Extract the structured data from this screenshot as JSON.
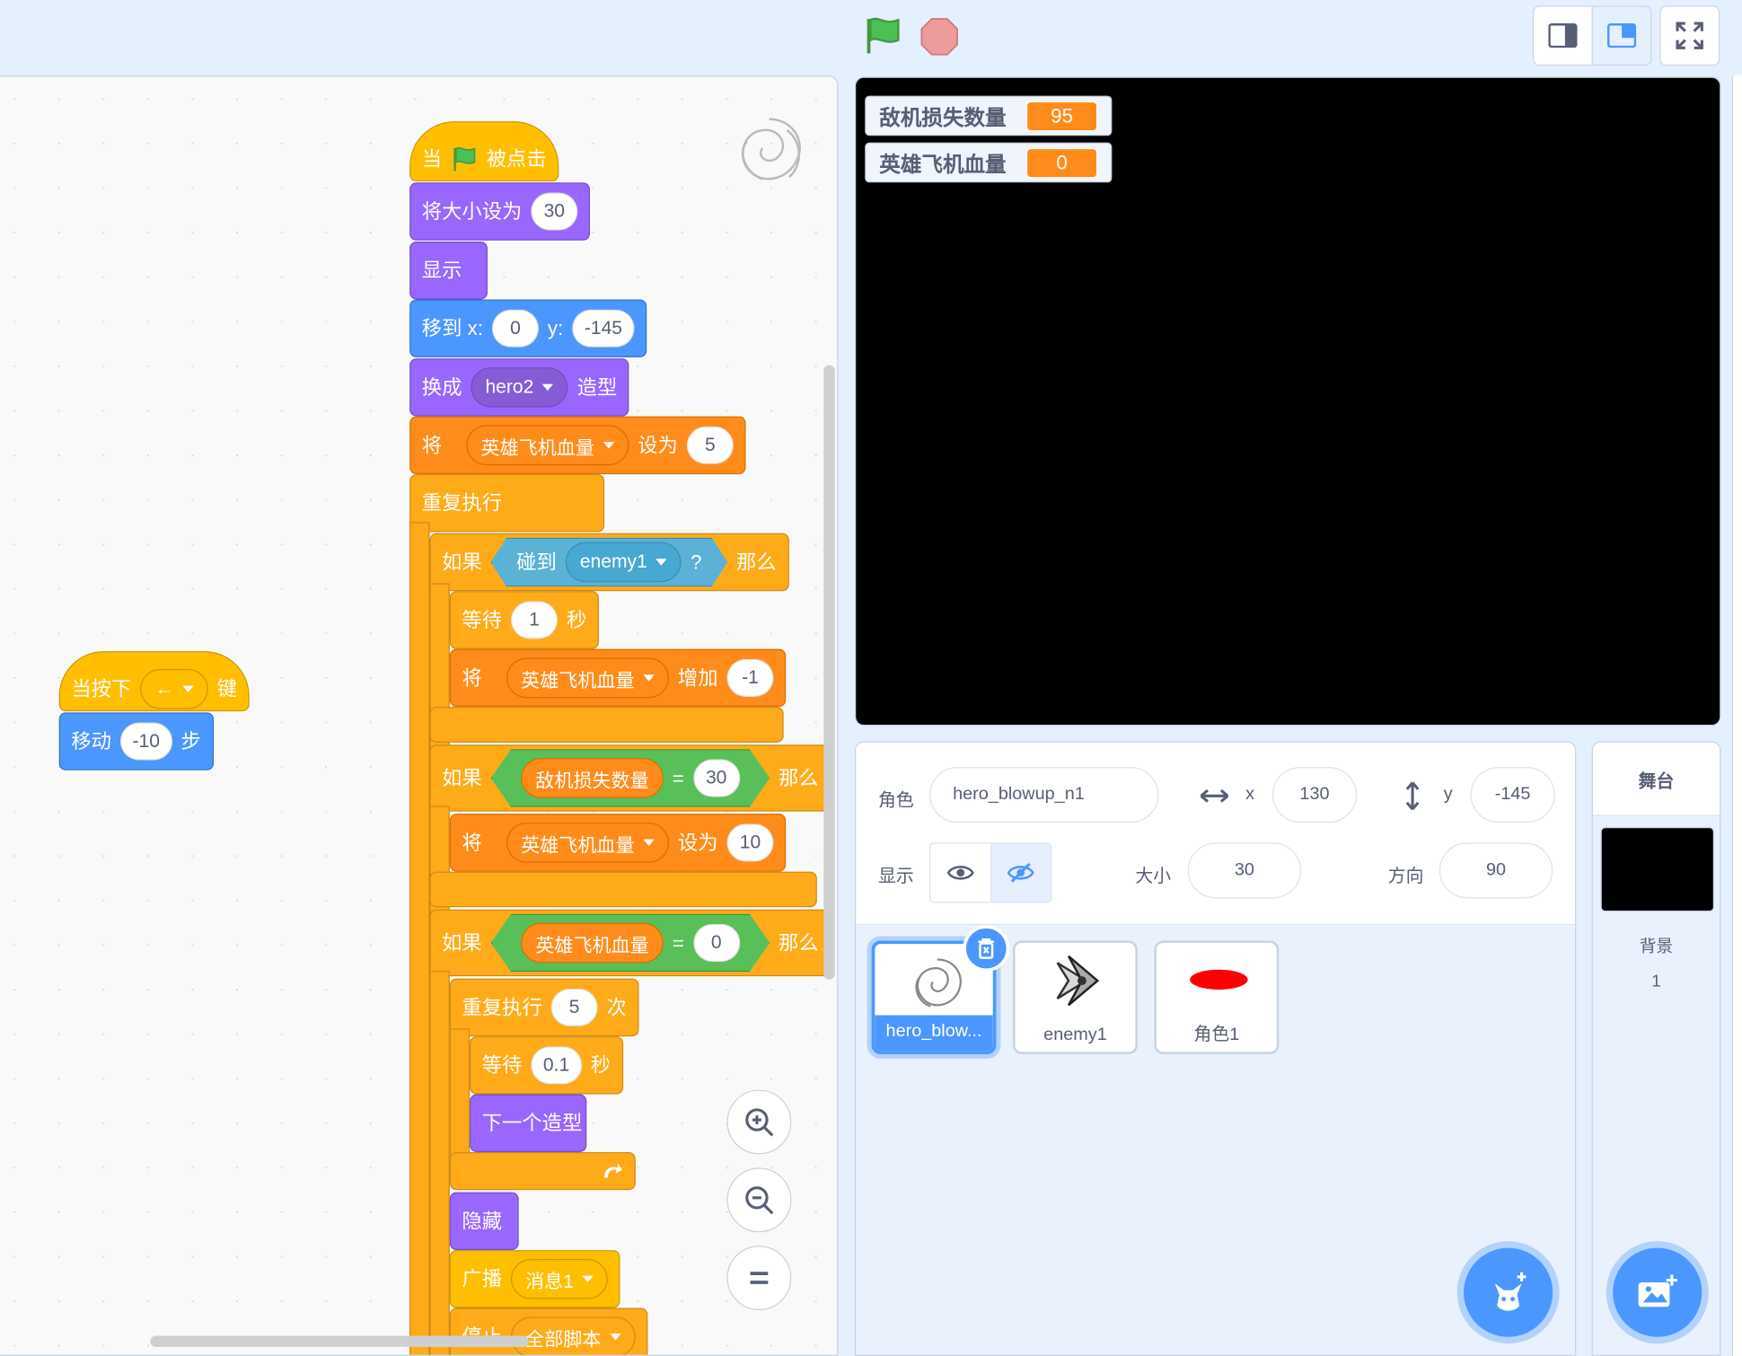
{
  "toolbar": {
    "green_flag_icon": "green-flag-icon",
    "stop_icon": "stop-icon",
    "layout_buttons": [
      "small-stage-icon",
      "normal-stage-icon",
      "fullscreen-icon"
    ]
  },
  "scripts": {
    "key_script": {
      "hat_prefix": "当按下",
      "key_value": "←",
      "hat_suffix": "键",
      "move_label": "移动",
      "move_value": "-10",
      "move_suffix": "步"
    },
    "main_script": {
      "hat_when": "当",
      "hat_clicked": "被点击",
      "set_size_label": "将大小设为",
      "set_size_value": "30",
      "show_label": "显示",
      "goto_label": "移到 x:",
      "goto_x": "0",
      "goto_y_label": "y:",
      "goto_y": "-145",
      "switch_label": "换成",
      "switch_costume": "hero2",
      "switch_suffix": "造型",
      "set_var_label": "将",
      "set_var_name": "英雄飞机血量",
      "set_var_to": "设为",
      "set_var_value": "5",
      "forever_label": "重复执行",
      "if1_label": "如果",
      "touching_label": "碰到",
      "touching_target": "enemy1",
      "touching_q": "?",
      "then_label": "那么",
      "wait1_label": "等待",
      "wait1_value": "1",
      "wait1_unit": "秒",
      "change_label": "将",
      "change_var": "英雄飞机血量",
      "change_by": "增加",
      "change_value": "-1",
      "if2_label": "如果",
      "if2_var": "敌机损失数量",
      "if2_eq": "=",
      "if2_value": "30",
      "if2_then": "那么",
      "set2_label": "将",
      "set2_var": "英雄飞机血量",
      "set2_to": "设为",
      "set2_value": "10",
      "if3_label": "如果",
      "if3_var": "英雄飞机血量",
      "if3_eq": "=",
      "if3_value": "0",
      "if3_then": "那么",
      "repeat_label": "重复执行",
      "repeat_value": "5",
      "repeat_unit": "次",
      "wait2_label": "等待",
      "wait2_value": "0.1",
      "wait2_unit": "秒",
      "next_costume": "下一个造型",
      "hide_label": "隐藏",
      "broadcast_label": "广播",
      "broadcast_msg": "消息1",
      "stop_label": "停止",
      "stop_option": "全部脚本"
    }
  },
  "stage": {
    "monitors": [
      {
        "label": "敌机损失数量",
        "value": "95"
      },
      {
        "label": "英雄飞机血量",
        "value": "0"
      }
    ]
  },
  "sprite_info": {
    "sprite_label": "角色",
    "sprite_name": "hero_blowup_n1",
    "x_label": "x",
    "x_value": "130",
    "y_label": "y",
    "y_value": "-145",
    "show_label": "显示",
    "size_label": "大小",
    "size_value": "30",
    "direction_label": "方向",
    "direction_value": "90"
  },
  "sprites": [
    {
      "name": "hero_blow...",
      "selected": true
    },
    {
      "name": "enemy1",
      "selected": false
    },
    {
      "name": "角色1",
      "selected": false
    }
  ],
  "stage_panel": {
    "title": "舞台",
    "backdrop_label": "背景",
    "backdrop_count": "1"
  },
  "colors": {
    "events": "#ffbf00",
    "looks": "#9966ff",
    "motion": "#4c97ff",
    "variables": "#ff8c1a",
    "control": "#ffab19",
    "sensing": "#5cb1d6",
    "operators": "#59c059"
  }
}
